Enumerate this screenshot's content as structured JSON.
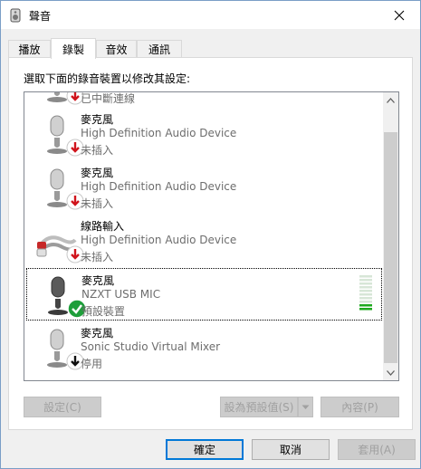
{
  "window": {
    "title": "聲音"
  },
  "tabs": [
    {
      "label": "播放"
    },
    {
      "label": "錄製"
    },
    {
      "label": "音效"
    },
    {
      "label": "通訊"
    }
  ],
  "instructions": "選取下面的錄音裝置以修改其設定:",
  "devices": [
    {
      "name": "",
      "desc": "",
      "status": "已中斷連線",
      "icon": "microphone-icon",
      "badge": "down-arrow-red-icon"
    },
    {
      "name": "麥克風",
      "desc": "High Definition Audio Device",
      "status": "未插入",
      "icon": "microphone-icon",
      "badge": "down-arrow-red-icon"
    },
    {
      "name": "麥克風",
      "desc": "High Definition Audio Device",
      "status": "未插入",
      "icon": "microphone-icon",
      "badge": "down-arrow-red-icon"
    },
    {
      "name": "線路輸入",
      "desc": "High Definition Audio Device",
      "status": "未插入",
      "icon": "rca-cable-icon",
      "badge": "down-arrow-red-icon"
    },
    {
      "name": "麥克風",
      "desc": "NZXT USB MIC",
      "status": "預設裝置",
      "icon": "microphone-icon",
      "badge": "check-green-icon"
    },
    {
      "name": "麥克風",
      "desc": "Sonic Studio Virtual Mixer",
      "status": "停用",
      "icon": "microphone-icon",
      "badge": "down-arrow-black-icon"
    }
  ],
  "panel_buttons": {
    "configure": "設定(C)",
    "set_default": "設為預設值(S)",
    "properties": "內容(P)"
  },
  "dialog_buttons": {
    "ok": "確定",
    "cancel": "取消",
    "apply": "套用(A)"
  },
  "colors": {
    "accent": "#0078d7",
    "disabled_text": "#a0a0a0",
    "status_text": "#6d6d6d",
    "level_active": "#1ea91e"
  },
  "level_meter": {
    "active_fraction": 0.2
  }
}
